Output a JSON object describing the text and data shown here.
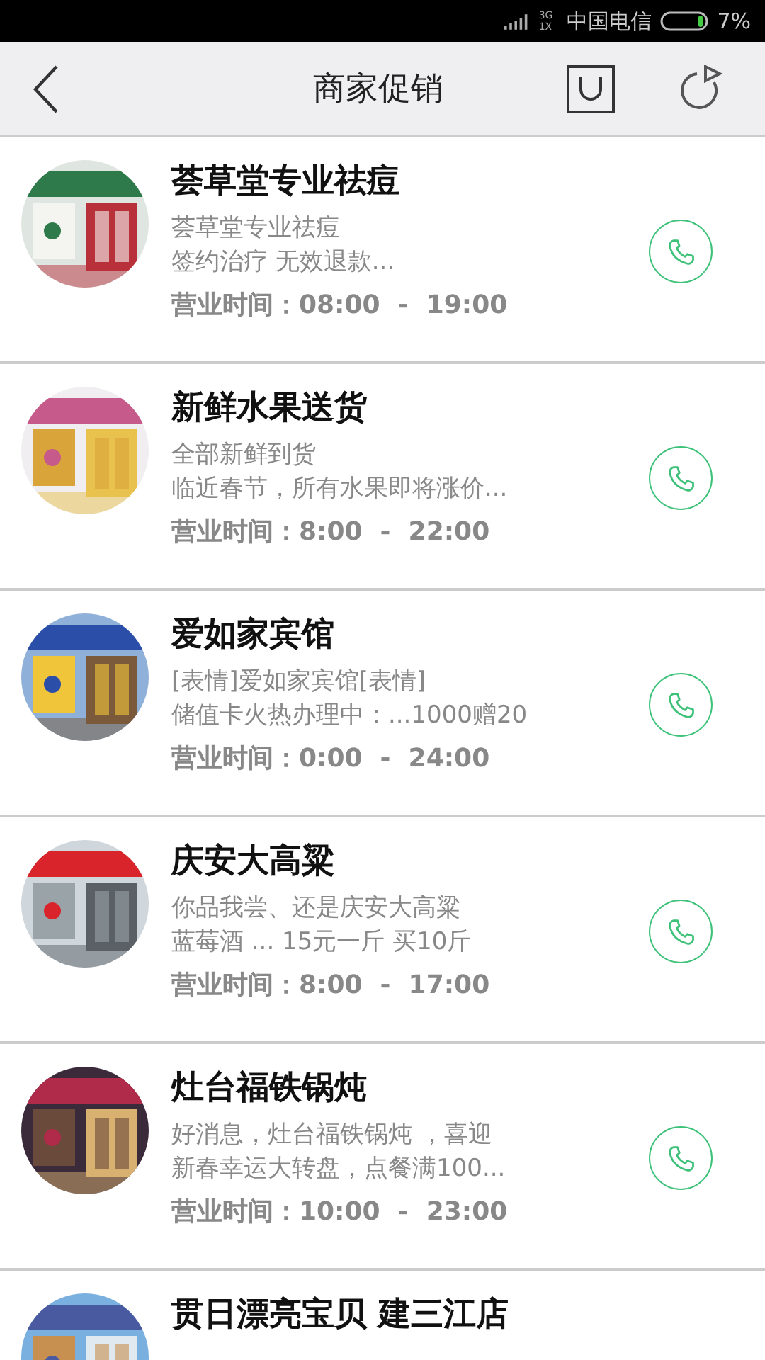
{
  "status_bar": {
    "network": [
      "3G",
      "1X"
    ],
    "carrier": "中国电信",
    "battery": "7%"
  },
  "header": {
    "title": "商家促销"
  },
  "merchants": [
    {
      "name": "荟草堂专业祛痘",
      "desc": [
        "荟草堂专业祛痘",
        "签约治疗 无效退款..."
      ],
      "hours": "营业时间：08:00  -  19:00"
    },
    {
      "name": "新鲜水果送货",
      "desc": [
        "全部新鲜到货",
        "临近春节，所有水果即将涨价..."
      ],
      "hours": "营业时间：8:00  -  22:00"
    },
    {
      "name": "爱如家宾馆",
      "desc": [
        "[表情]爱如家宾馆[表情]",
        "储值卡火热办理中：...1000赠20"
      ],
      "hours": "营业时间：0:00  -  24:00"
    },
    {
      "name": "庆安大高粱",
      "desc": [
        "你品我尝、还是庆安大高粱",
        "蓝莓酒 ... 15元一斤  买10斤"
      ],
      "hours": "营业时间：8:00  -  17:00"
    },
    {
      "name": "灶台福铁锅炖",
      "desc": [
        "好消息，灶台福铁锅炖 ，喜迎",
        "新春幸运大转盘，点餐满100..."
      ],
      "hours": "营业时间：10:00  -  23:00"
    },
    {
      "name": "贯日漂亮宝贝 建三江店"
    }
  ]
}
